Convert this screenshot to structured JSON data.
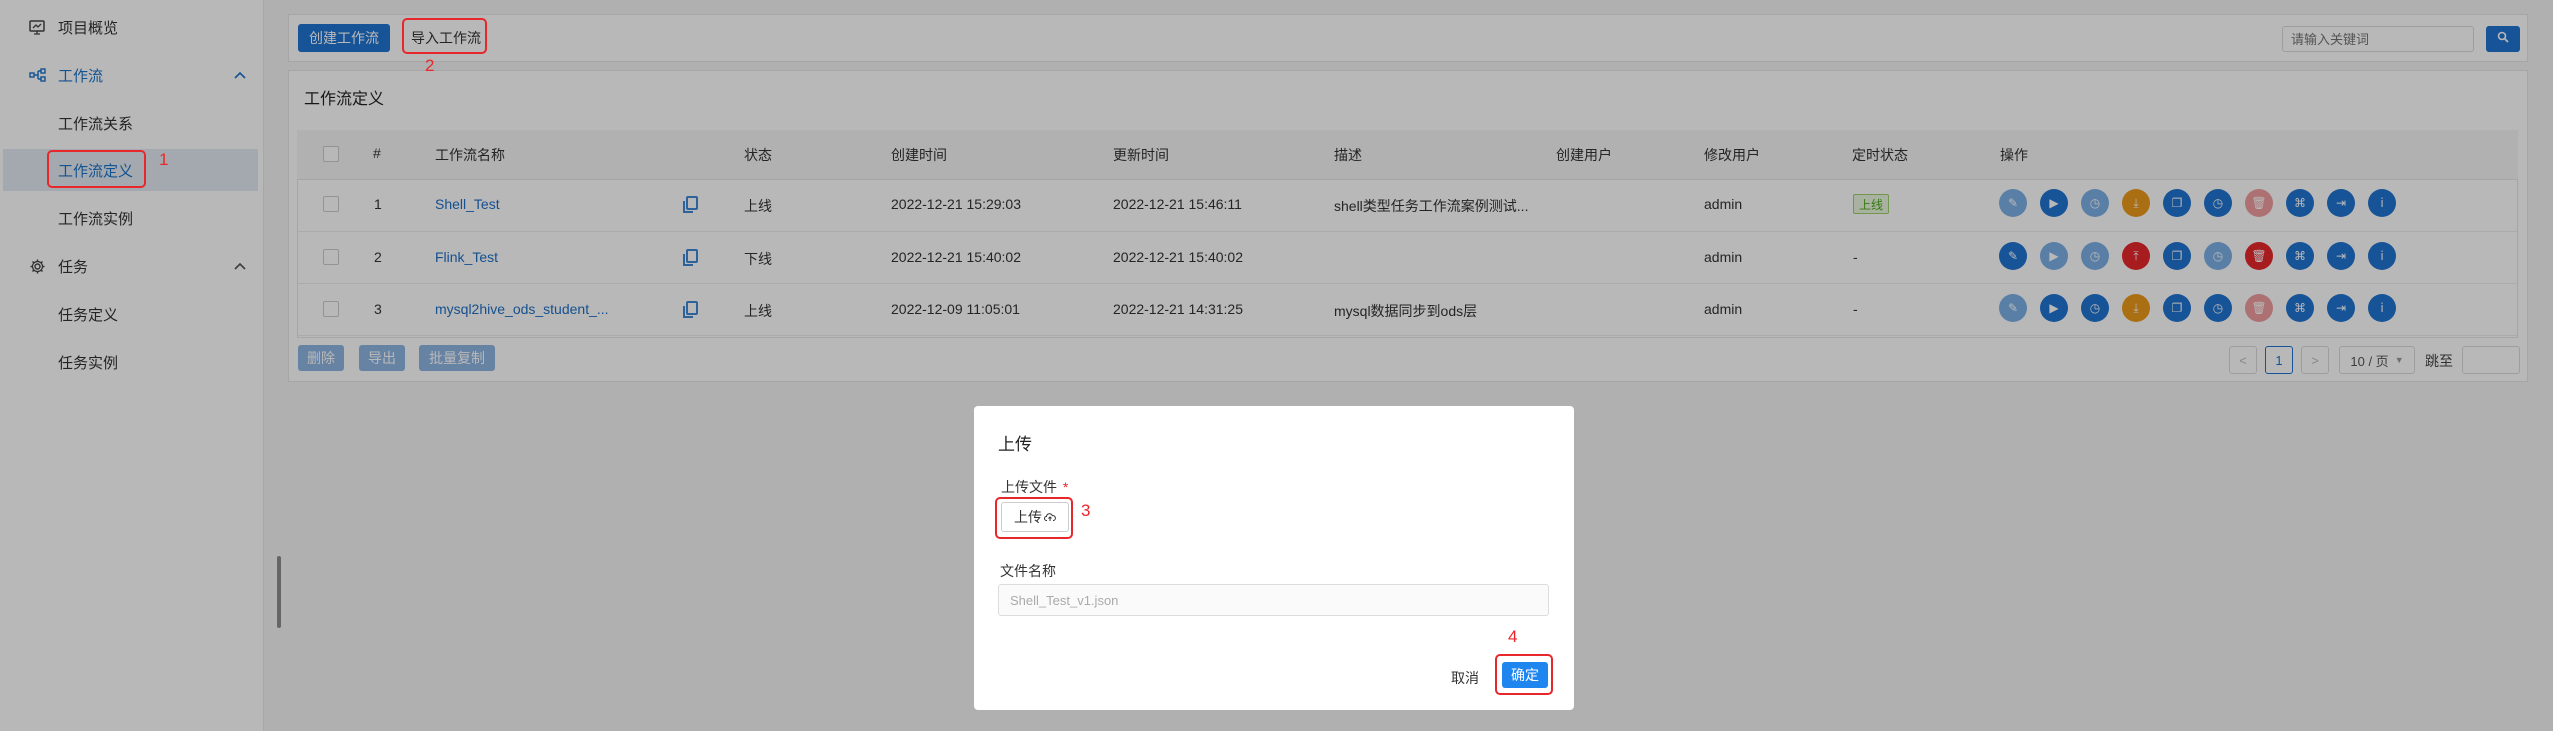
{
  "sidebar": {
    "overview": "项目概览",
    "workflow": "工作流",
    "workflow_relation": "工作流关系",
    "workflow_definition": "工作流定义",
    "workflow_instance": "工作流实例",
    "task": "任务",
    "task_definition": "任务定义",
    "task_instance": "任务实例"
  },
  "toolbar": {
    "create_label": "创建工作流",
    "import_label": "导入工作流",
    "search_placeholder": "请输入关键词"
  },
  "card": {
    "title": "工作流定义"
  },
  "table": {
    "headers": [
      "#",
      "工作流名称",
      "状态",
      "创建时间",
      "更新时间",
      "描述",
      "创建用户",
      "修改用户",
      "定时状态",
      "操作"
    ],
    "rows": [
      {
        "id": "1",
        "name": "Shell_Test",
        "status": "上线",
        "created": "2022-12-21 15:29:03",
        "updated": "2022-12-21 15:46:11",
        "desc": "shell类型任务工作流案例测试...",
        "creator": "",
        "modifier": "admin",
        "schedule": "上线"
      },
      {
        "id": "2",
        "name": "Flink_Test",
        "status": "下线",
        "created": "2022-12-21 15:40:02",
        "updated": "2022-12-21 15:40:02",
        "desc": "",
        "creator": "",
        "modifier": "admin",
        "schedule": "-"
      },
      {
        "id": "3",
        "name": "mysql2hive_ods_student_...",
        "status": "上线",
        "created": "2022-12-09 11:05:01",
        "updated": "2022-12-21 14:31:25",
        "desc": "mysql数据同步到ods层",
        "creator": "",
        "modifier": "admin",
        "schedule": "-"
      }
    ]
  },
  "footer": {
    "delete": "删除",
    "export": "导出",
    "batch_copy": "批量复制"
  },
  "pager": {
    "prev": "<",
    "page": "1",
    "next": ">",
    "page_size": "10 / 页",
    "jump": "跳至"
  },
  "annotations": {
    "n1": "1",
    "n2": "2",
    "n3": "3",
    "n4": "4"
  },
  "modal": {
    "title": "上传",
    "upload_label": "上传文件",
    "required": "*",
    "upload_button": "上传",
    "filename_label": "文件名称",
    "filename_value": "Shell_Test_v1.json",
    "cancel": "取消",
    "confirm": "确定"
  },
  "colors": {
    "primary": "#1f73d2",
    "annotation": "#e8272b",
    "orange": "#ec9a1a",
    "online_badge": "#4caa1a"
  }
}
